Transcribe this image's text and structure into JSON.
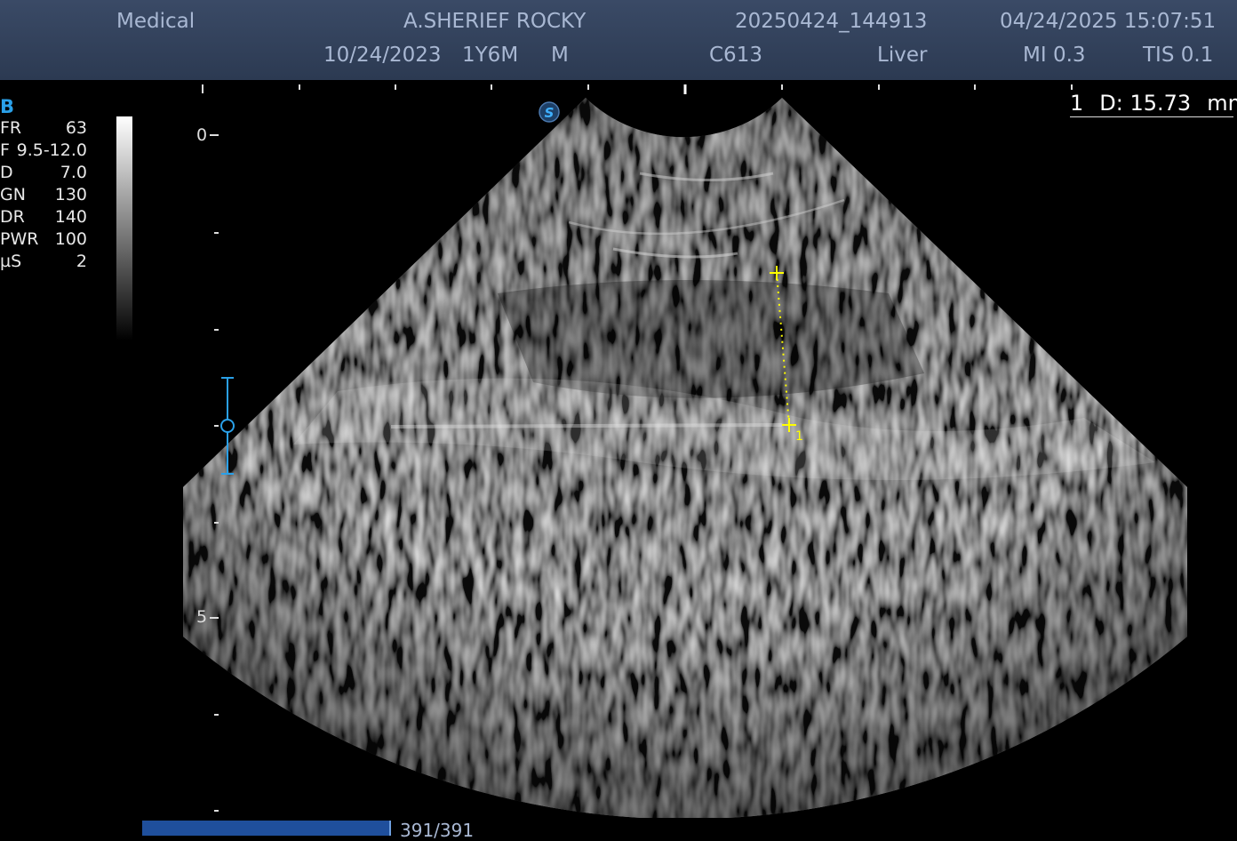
{
  "header": {
    "hospital": "Medical",
    "patient_name": "A.SHERIEF ROCKY",
    "exam_id": "20250424_144913",
    "datetime": "04/24/2025 15:07:51",
    "dob": "10/24/2023",
    "age": "1Y6M",
    "sex": "M",
    "probe": "C613",
    "preset": "Liver",
    "mi": "MI 0.3",
    "tis": "TIS 0.1"
  },
  "imaging_params": {
    "mode": "B",
    "items": [
      {
        "key": "FR",
        "value": "63"
      },
      {
        "key": "F",
        "value": "9.5-12.0"
      },
      {
        "key": "D",
        "value": "7.0"
      },
      {
        "key": "GN",
        "value": "130"
      },
      {
        "key": "DR",
        "value": "140"
      },
      {
        "key": "PWR",
        "value": "100"
      },
      {
        "key": "µS",
        "value": "2"
      }
    ]
  },
  "depth_scale": {
    "label_0": "0",
    "label_5": "5"
  },
  "probe_marker": {
    "label": "S"
  },
  "measurement": {
    "index": "1",
    "label": "D: 15.73",
    "unit": "mm",
    "caliper_index": "1",
    "color": "#ffff00"
  },
  "cine": {
    "frame_count": "391/391",
    "progress": 1.0
  },
  "colors": {
    "header_text": "#a9b8d3",
    "accent_blue": "#2aa0e8",
    "cine_bar": "#1f4f9c"
  }
}
